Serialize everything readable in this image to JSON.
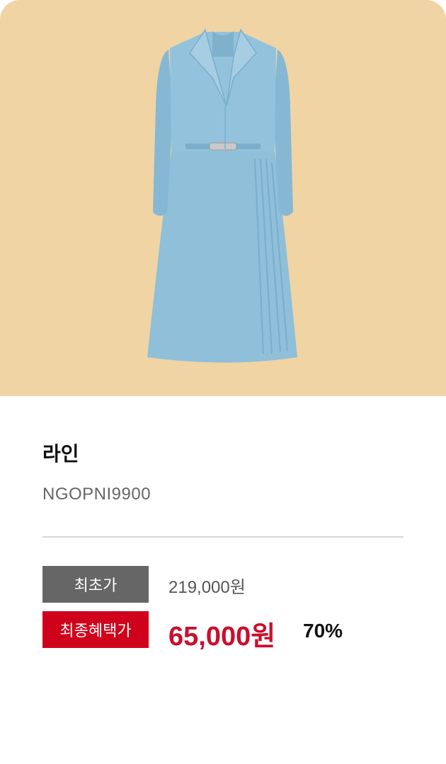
{
  "product": {
    "image_alt": "light blue tailored coat dress with belt",
    "brand": "라인",
    "code": "NGOPNI9900"
  },
  "price": {
    "original_label": "최초가",
    "original_value": "219,000원",
    "final_label": "최종혜택가",
    "final_value": "65,000원",
    "discount_rate": "70%"
  },
  "colors": {
    "image_bg": "#f0d4a4",
    "dress": "#8fbfd9",
    "original_badge": "#666666",
    "final_badge": "#d0021b",
    "final_price": "#c8102e"
  }
}
